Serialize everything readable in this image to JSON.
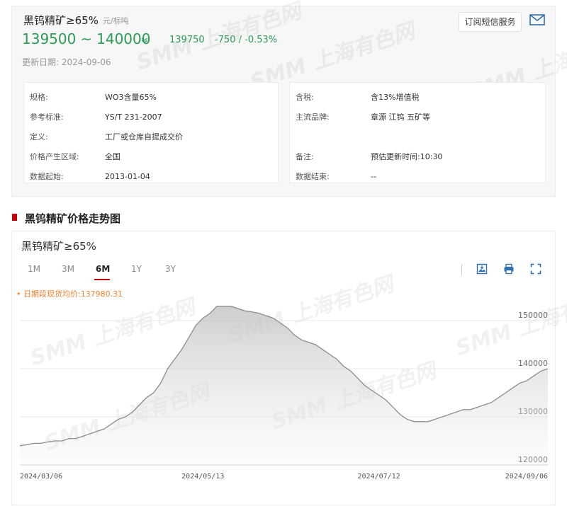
{
  "product": {
    "name": "黑钨精矿≥65%",
    "unit": "元/标吨",
    "price_low": "139500",
    "price_sep": "~",
    "price_high": "140000",
    "avg": "139750",
    "change": "-750  /  -0.53%",
    "update_label": "更新日期:",
    "update_date": "2024-09-06",
    "trend_icon": "chevron-down-icon",
    "color_down": "#2c9b56"
  },
  "header": {
    "subscribe_label": "订阅短信服务",
    "mail_icon": "mail-icon"
  },
  "specs_left": [
    {
      "k": "规格:",
      "v": "WO3含量65%"
    },
    {
      "k": "参考标准:",
      "v": "YS/T 231-2007"
    },
    {
      "k": "定义:",
      "v": "工厂或仓库自提成交价"
    },
    {
      "k": "价格产生区域:",
      "v": "全国"
    },
    {
      "k": "数据起始:",
      "v": "2013-01-04"
    }
  ],
  "specs_right": [
    {
      "k": "含税:",
      "v": "含13%增值税"
    },
    {
      "k": "主流品牌:",
      "v": "章源 江钨 五矿等"
    },
    {
      "k": "备注:",
      "v": "预估更新时间:10:30"
    },
    {
      "k": "数据结束:",
      "v": "--"
    }
  ],
  "section": {
    "title": "黑钨精矿价格走势图",
    "accent": "#c8000a"
  },
  "chart_panel": {
    "title": "黑钨精矿≥65%",
    "tabs": [
      "1M",
      "3M",
      "6M",
      "1Y",
      "3Y"
    ],
    "active_tab": "6M",
    "avg_note": "• 日期段现货均价:137980.31",
    "tools": [
      "download-image-icon",
      "print-icon",
      "fullscreen-icon"
    ]
  },
  "watermark": "SMM 上海有色网",
  "chart_data": {
    "type": "area",
    "title": "黑钨精矿≥65%",
    "xlabel": "",
    "ylabel": "",
    "ylim": [
      120000,
      155000
    ],
    "yticks": [
      120000,
      130000,
      140000,
      150000
    ],
    "xticks": [
      "2024/03/06",
      "2024/05/13",
      "2024/07/12",
      "2024/09/06"
    ],
    "grid": "horizontal",
    "x": [
      "2024/03/06",
      "2024/03/08",
      "2024/03/11",
      "2024/03/13",
      "2024/03/15",
      "2024/03/18",
      "2024/03/20",
      "2024/03/22",
      "2024/03/25",
      "2024/03/27",
      "2024/03/29",
      "2024/04/01",
      "2024/04/03",
      "2024/04/08",
      "2024/04/10",
      "2024/04/12",
      "2024/04/15",
      "2024/04/17",
      "2024/04/19",
      "2024/04/22",
      "2024/04/24",
      "2024/04/26",
      "2024/04/29",
      "2024/05/06",
      "2024/05/08",
      "2024/05/10",
      "2024/05/13",
      "2024/05/15",
      "2024/05/17",
      "2024/05/20",
      "2024/05/22",
      "2024/05/24",
      "2024/05/27",
      "2024/05/29",
      "2024/05/31",
      "2024/06/03",
      "2024/06/05",
      "2024/06/07",
      "2024/06/11",
      "2024/06/13",
      "2024/06/17",
      "2024/06/19",
      "2024/06/21",
      "2024/06/24",
      "2024/06/26",
      "2024/06/28",
      "2024/07/01",
      "2024/07/03",
      "2024/07/05",
      "2024/07/08",
      "2024/07/10",
      "2024/07/12",
      "2024/07/15",
      "2024/07/17",
      "2024/07/19",
      "2024/07/22",
      "2024/07/24",
      "2024/07/26",
      "2024/07/29",
      "2024/07/31",
      "2024/08/02",
      "2024/08/05",
      "2024/08/07",
      "2024/08/09",
      "2024/08/12",
      "2024/08/14",
      "2024/08/16",
      "2024/08/19",
      "2024/08/21",
      "2024/08/23",
      "2024/08/26",
      "2024/08/28",
      "2024/08/30",
      "2024/09/02",
      "2024/09/04",
      "2024/09/06"
    ],
    "series": [
      {
        "values": [
          124000,
          124200,
          124500,
          124500,
          124800,
          125000,
          125000,
          125500,
          125500,
          126000,
          126500,
          127000,
          127500,
          128500,
          129500,
          130000,
          131000,
          132500,
          134000,
          135000,
          137000,
          140000,
          142000,
          144000,
          146500,
          149000,
          150500,
          151500,
          153000,
          153000,
          153000,
          152500,
          152000,
          151800,
          151500,
          151000,
          150500,
          149500,
          148500,
          147000,
          146000,
          145500,
          145000,
          144000,
          143000,
          142000,
          140500,
          139500,
          138000,
          136500,
          135500,
          134500,
          133500,
          132000,
          130500,
          129500,
          129000,
          129000,
          129000,
          129500,
          130000,
          130500,
          131000,
          131500,
          131500,
          132000,
          132500,
          133000,
          134000,
          135000,
          136000,
          137000,
          137500,
          138500,
          139500,
          140000
        ]
      }
    ]
  }
}
